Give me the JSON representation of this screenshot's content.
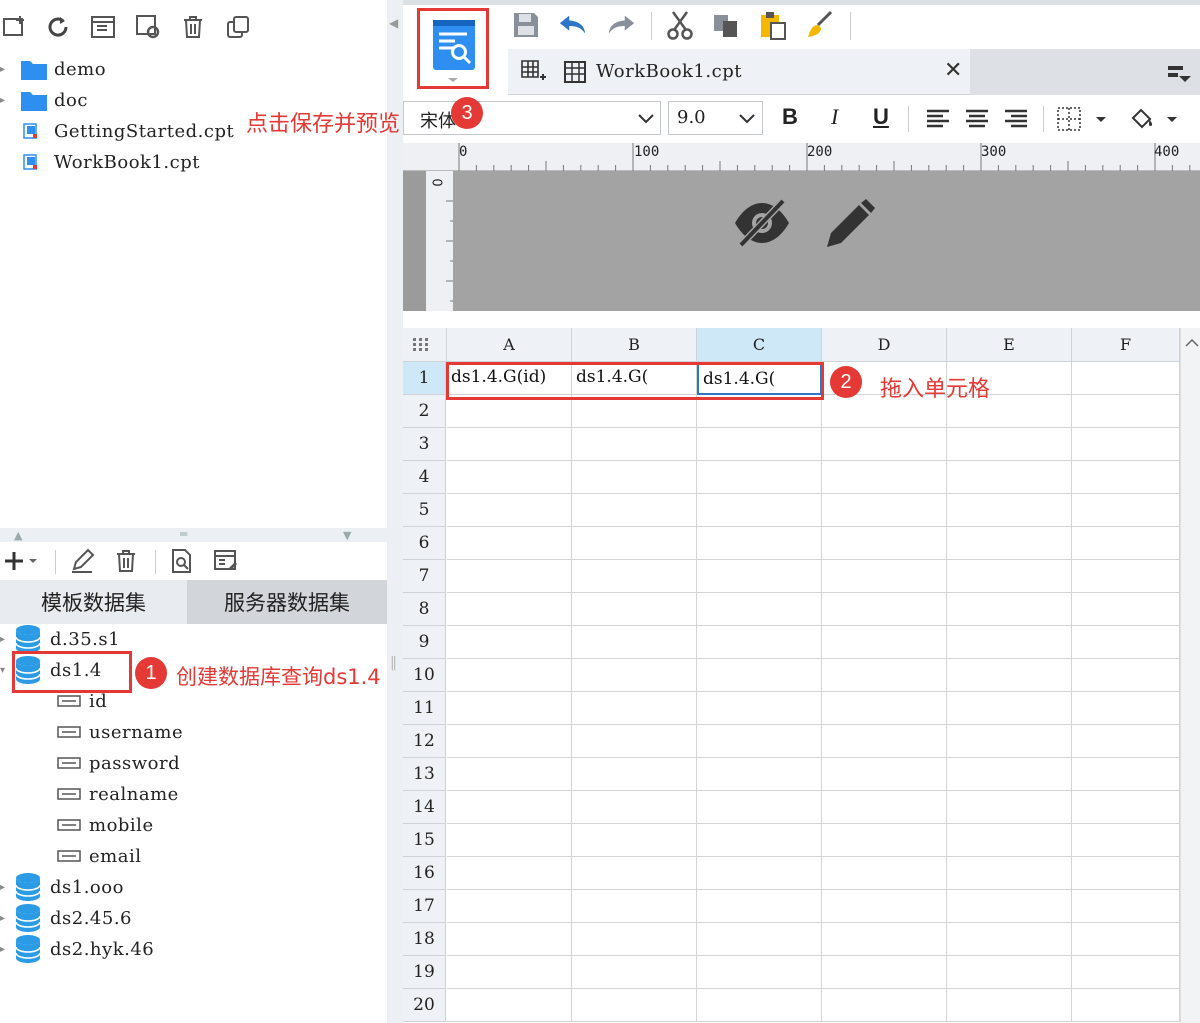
{
  "file_tree": [
    {
      "label": "demo",
      "type": "folder"
    },
    {
      "label": "doc",
      "type": "folder"
    },
    {
      "label": "GettingStarted.cpt",
      "type": "file"
    },
    {
      "label": "WorkBook1.cpt",
      "type": "file"
    }
  ],
  "dataset_tabs": {
    "template": "模板数据集",
    "server": "服务器数据集"
  },
  "datasets": [
    {
      "label": "d.35.s1"
    },
    {
      "label": "ds1.4",
      "expanded": true,
      "fields": [
        "id",
        "username",
        "password",
        "realname",
        "mobile",
        "email"
      ]
    },
    {
      "label": "ds1.ooo"
    },
    {
      "label": "ds2.45.6"
    },
    {
      "label": "ds2.hyk.46"
    }
  ],
  "editor": {
    "tab_label": "WorkBook1.cpt",
    "font_name": "宋体",
    "font_size": "9.0",
    "bold": "B",
    "italic": "I",
    "underline": "U",
    "ruler_ticks": [
      "0",
      "100",
      "200",
      "300",
      "400"
    ],
    "vruler_tick": "0"
  },
  "sheet": {
    "columns": [
      "A",
      "B",
      "C",
      "D",
      "E",
      "F"
    ],
    "rows": [
      "1",
      "2",
      "3",
      "4",
      "5",
      "6",
      "7",
      "8",
      "9",
      "10",
      "11",
      "12",
      "13",
      "14",
      "15",
      "16",
      "17",
      "18",
      "19",
      "20"
    ],
    "cells": {
      "A1": "ds1.4.G(id)",
      "B1": "ds1.4.G(",
      "C1": "ds1.4.G("
    }
  },
  "annotations": {
    "n1": "1",
    "t1": "创建数据库查询ds1.4",
    "n2": "2",
    "t2": "拖入单元格",
    "n3": "3",
    "t3": "点击保存并预览"
  },
  "colors": {
    "accent": "#e53935",
    "folder": "#2e8ff0",
    "db": "#2b9be6",
    "selected_col": "#cfe8f7"
  }
}
